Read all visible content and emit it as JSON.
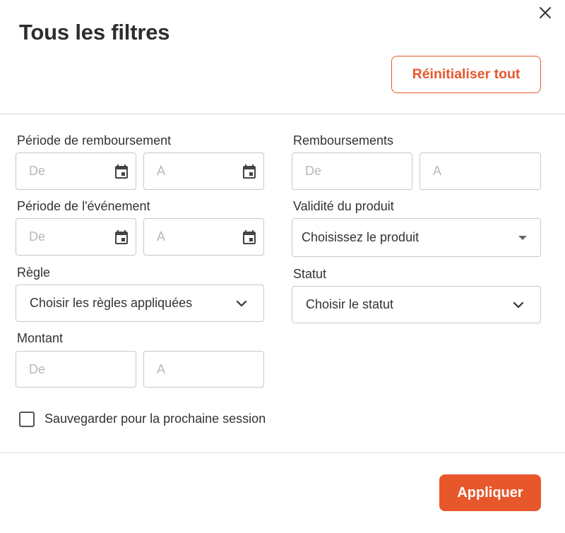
{
  "dialog": {
    "title": "Tous les filtres",
    "close_icon": "close-icon",
    "reset_label": "Réinitialiser tout",
    "apply_label": "Appliquer"
  },
  "filters": {
    "refund_period": {
      "label": "Période de remboursement",
      "from_placeholder": "De",
      "to_placeholder": "A",
      "icon": "calendar-icon"
    },
    "event_period": {
      "label": "Période de l'événement",
      "from_placeholder": "De",
      "to_placeholder": "A",
      "icon": "calendar-icon"
    },
    "rule": {
      "label": "Règle",
      "value": "Choisir les règles appliquées"
    },
    "amount": {
      "label": "Montant",
      "from_placeholder": "De",
      "to_placeholder": "A"
    },
    "refunds": {
      "label": "Remboursements",
      "from_placeholder": "De",
      "to_placeholder": "A"
    },
    "product_validity": {
      "label": "Validité du produit",
      "value": "Choisissez le produit"
    },
    "status": {
      "label": "Statut",
      "value": "Choisir le statut"
    }
  },
  "save_session": {
    "label": "Sauvegarder pour la prochaine session",
    "checked": false
  },
  "colors": {
    "accent": "#e8572b",
    "border": "#c8c8c8",
    "placeholder": "#b8b8b8",
    "text": "#333333"
  }
}
